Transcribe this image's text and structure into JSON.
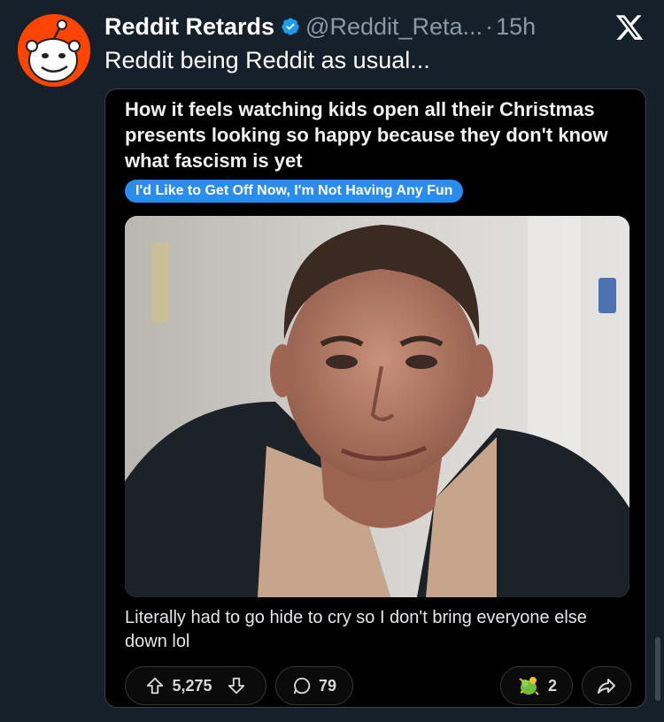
{
  "tweet": {
    "author_name": "Reddit Retards",
    "handle": "@Reddit_Reta...",
    "separator": "·",
    "time": "15h",
    "text": "Reddit being Reddit as usual..."
  },
  "post": {
    "title": "How it feels watching kids open all their Christmas presents looking so happy because they don't know what fascism is yet",
    "flair": "I'd Like to Get Off Now, I'm Not Having Any Fun",
    "comment": "Literally had to go hide to cry so I don't bring everyone else down lol"
  },
  "actions": {
    "upvotes": "5,275",
    "comments": "79",
    "awards": "2"
  },
  "icons": {
    "avatar": "reddit-avatar-icon",
    "verified": "verified-badge-icon",
    "x_logo": "x-logo-icon",
    "upvote": "upvote-icon",
    "downvote": "downvote-icon",
    "comment": "comment-icon",
    "award": "award-icon",
    "share": "share-icon"
  },
  "colors": {
    "background": "#15202b",
    "accent_verified": "#1d9bf0",
    "reddit_orange": "#ff4500",
    "flair_blue": "#2b8cf0",
    "card_background": "#000000"
  }
}
